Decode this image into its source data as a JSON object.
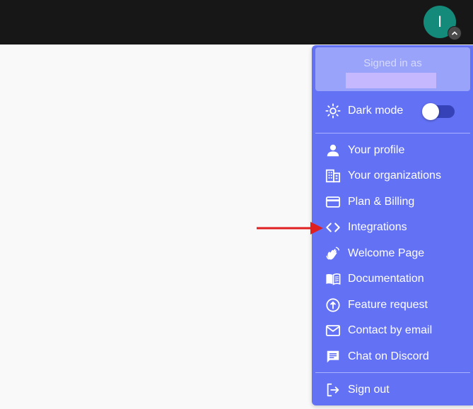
{
  "header": {
    "avatar_initial": "I"
  },
  "menu": {
    "signed_in_label": "Signed in as",
    "dark_mode_label": "Dark mode",
    "dark_mode_on": false,
    "items": [
      {
        "label": "Your profile",
        "icon": "person-icon"
      },
      {
        "label": "Your organizations",
        "icon": "building-icon"
      },
      {
        "label": "Plan & Billing",
        "icon": "credit-card-icon"
      },
      {
        "label": "Integrations",
        "icon": "code-icon"
      },
      {
        "label": "Welcome Page",
        "icon": "waving-hand-icon"
      },
      {
        "label": "Documentation",
        "icon": "book-icon"
      },
      {
        "label": "Feature request",
        "icon": "arrow-up-circle-icon"
      },
      {
        "label": "Contact by email",
        "icon": "mail-icon"
      },
      {
        "label": "Chat on Discord",
        "icon": "chat-icon"
      }
    ],
    "sign_out_label": "Sign out"
  },
  "colors": {
    "topbar": "#171717",
    "avatar": "#138a7a",
    "menu_bg": "#6371f5",
    "signed_block": "#9aa3fa",
    "annotation_arrow": "#e02020"
  }
}
